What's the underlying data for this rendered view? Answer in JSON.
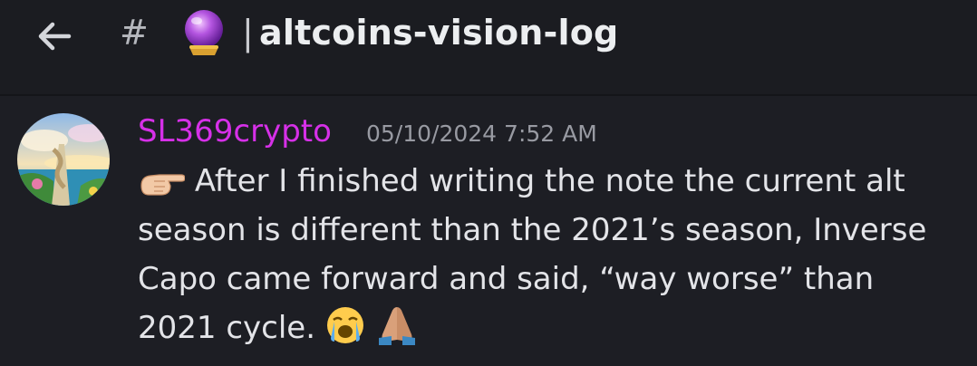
{
  "header": {
    "back_icon": "arrow-left-icon",
    "hash_symbol": "#",
    "channel_emoji_icon": "crystal-ball-icon",
    "separator": "|",
    "channel_name": "altcoins-vision-log"
  },
  "message": {
    "avatar_icon": "stairway-landscape-avatar",
    "author": "SL369crypto",
    "author_color": "#d630e8",
    "timestamp": "05/10/2024 7:52 AM",
    "lead_emoji_icon": "backhand-index-pointing-right-icon",
    "lines": [
      "After I finished writing the note the current alt",
      "season is different than the 2021’s season, Inverse",
      "Capo came forward and said, “way worse” than",
      "2021 cycle."
    ],
    "trailing_emoji_icons": [
      "loudly-crying-face-icon",
      "folded-hands-icon"
    ]
  }
}
